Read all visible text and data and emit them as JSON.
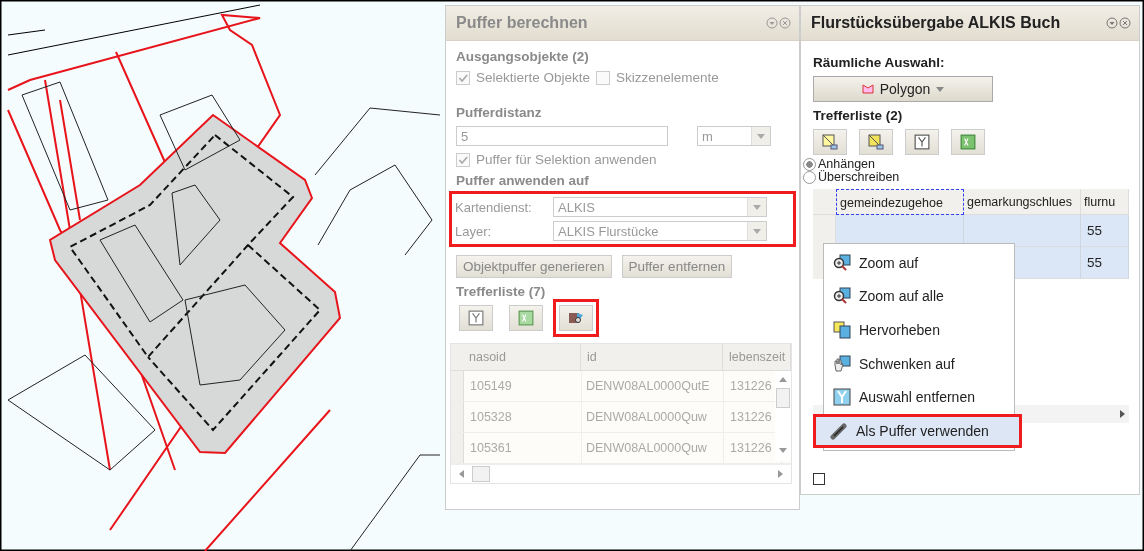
{
  "buffer_panel": {
    "title": "Puffer berechnen",
    "source_heading": "Ausgangsobjekte (2)",
    "source_options": [
      {
        "label": "Selektierte Objekte",
        "checked": true
      },
      {
        "label": "Skizzenelemente",
        "checked": false
      }
    ],
    "distance_heading": "Pufferdistanz",
    "distance": {
      "value": "5",
      "unit": "m"
    },
    "apply_selection": {
      "label": "Puffer für Selektion anwenden",
      "checked": true
    },
    "target_heading": "Puffer anwenden auf",
    "target_highlighted": true,
    "target_fields": [
      {
        "label": "Kartendienst:",
        "value": "ALKIS"
      },
      {
        "label": "Layer:",
        "value": "ALKIS Flurstücke"
      }
    ],
    "buttons": [
      "Objektpuffer generieren",
      "Puffer entfernen"
    ],
    "results_heading": "Trefferliste (7)",
    "toolbar": [
      {
        "kind": "clear",
        "highlighted": false
      },
      {
        "kind": "export",
        "highlighted": false
      },
      {
        "kind": "buffer",
        "highlighted": true
      }
    ],
    "table": {
      "columns": [
        "nasoid",
        "id",
        "lebenszeit"
      ],
      "rows": [
        [
          "105149",
          "DENW08AL0000QutE",
          "131226"
        ],
        [
          "105328",
          "DENW08AL0000Quw",
          "131226"
        ],
        [
          "105361",
          "DENW08AL0000Quw",
          "131226"
        ]
      ]
    }
  },
  "alkis_panel": {
    "title": "Flurstücksübergabe ALKIS Buch",
    "selection_label": "Räumliche Auswahl:",
    "polygon_button": "Polygon",
    "results_heading": "Trefferliste (2)",
    "toolbar": [
      {
        "kind": "select-add"
      },
      {
        "kind": "select-replace"
      },
      {
        "kind": "clear"
      },
      {
        "kind": "export"
      }
    ],
    "modes": [
      {
        "label": "Anhängen",
        "selected": true
      },
      {
        "label": "Überschreiben",
        "selected": false
      }
    ],
    "table": {
      "columns": [
        {
          "label": "gemeindezugehoe",
          "focused": true
        },
        {
          "label": "gemarkungschlues",
          "focused": false
        },
        {
          "label": "flurnu",
          "focused": false
        }
      ],
      "rows": [
        {
          "cells": [
            "",
            "",
            "55"
          ],
          "selected": true
        },
        {
          "cells": [
            "",
            "",
            "55"
          ],
          "selected": true
        }
      ]
    },
    "footer_checkbox": {
      "checked": false
    }
  },
  "context_menu": [
    {
      "kind": "zoom",
      "label": "Zoom auf",
      "highlighted": false
    },
    {
      "kind": "zoom",
      "label": "Zoom auf alle",
      "highlighted": false
    },
    {
      "kind": "highlight",
      "label": "Hervorheben",
      "highlighted": false
    },
    {
      "kind": "pan",
      "label": "Schwenken auf",
      "highlighted": false
    },
    {
      "kind": "clear",
      "label": "Auswahl entfernen",
      "highlighted": false
    },
    {
      "kind": "buffer",
      "label": "Als Puffer verwenden",
      "highlighted": true
    }
  ]
}
